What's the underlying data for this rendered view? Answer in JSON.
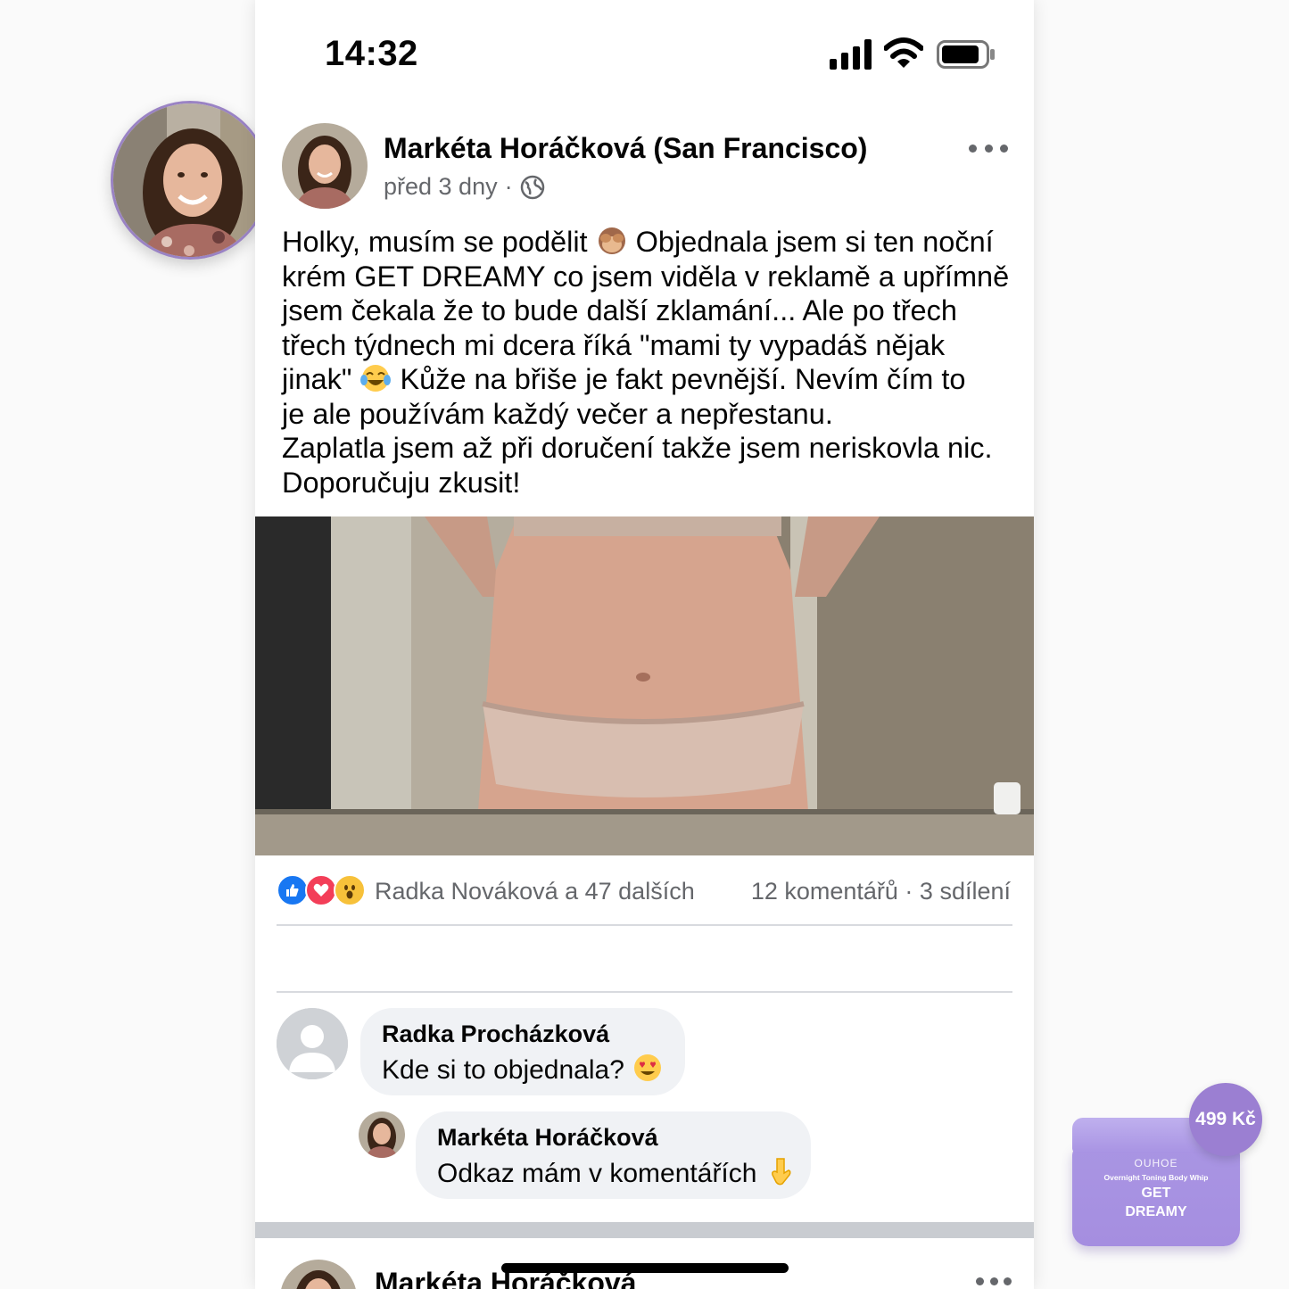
{
  "status_bar": {
    "time": "14:32"
  },
  "post": {
    "author": "Markéta Horáčková (San Francisco)",
    "time_ago": "před 3 dny",
    "meta_separator": "·",
    "text_lines": [
      "Holky, musím se podělit",
      "Objednala jsem si ten noční",
      "krém GET DREAMY co jsem viděla v reklamě a upřímně",
      "jsem čekala že to bude další zklamání... Ale po třech",
      "třech týdnech mi dcera říká \"mami ty vypadáš nějak",
      "jinak\"",
      "Kůže na břiše je fakt pevnější. Nevím čím to",
      "je ale používám každý večer a nepřestanu.",
      "Zaplatla jsem až při doručení takže jsem neriskovla nic.",
      "Doporučuju zkusit!"
    ],
    "emojis": [
      "see-no-evil-monkey",
      "tears-of-joy"
    ],
    "reactions": [
      "like",
      "love",
      "wow"
    ],
    "reactors_text": "Radka Nováková a 47 dalších",
    "counts_text": "12 komentářů · 3 sdílení"
  },
  "comments": [
    {
      "name": "Radka Procházková",
      "text": "Kde si to objednala?",
      "emoji": "heart-eyes"
    },
    {
      "name": "Markéta Horáčková",
      "text": "Odkaz mám v komentářích",
      "emoji": "pointing-down"
    }
  ],
  "next_post": {
    "author": "Markéta Horáčková"
  },
  "product": {
    "brand": "OUHOE",
    "subtitle": "Overnight Toning Body Whip",
    "name_line1": "GET",
    "name_line2": "DREAMY",
    "price": "499 Kč"
  },
  "colors": {
    "accent_purple": "#9b7fd2",
    "secondary_text": "#65676b",
    "like_blue": "#1877f2",
    "love_red": "#f33e58"
  }
}
